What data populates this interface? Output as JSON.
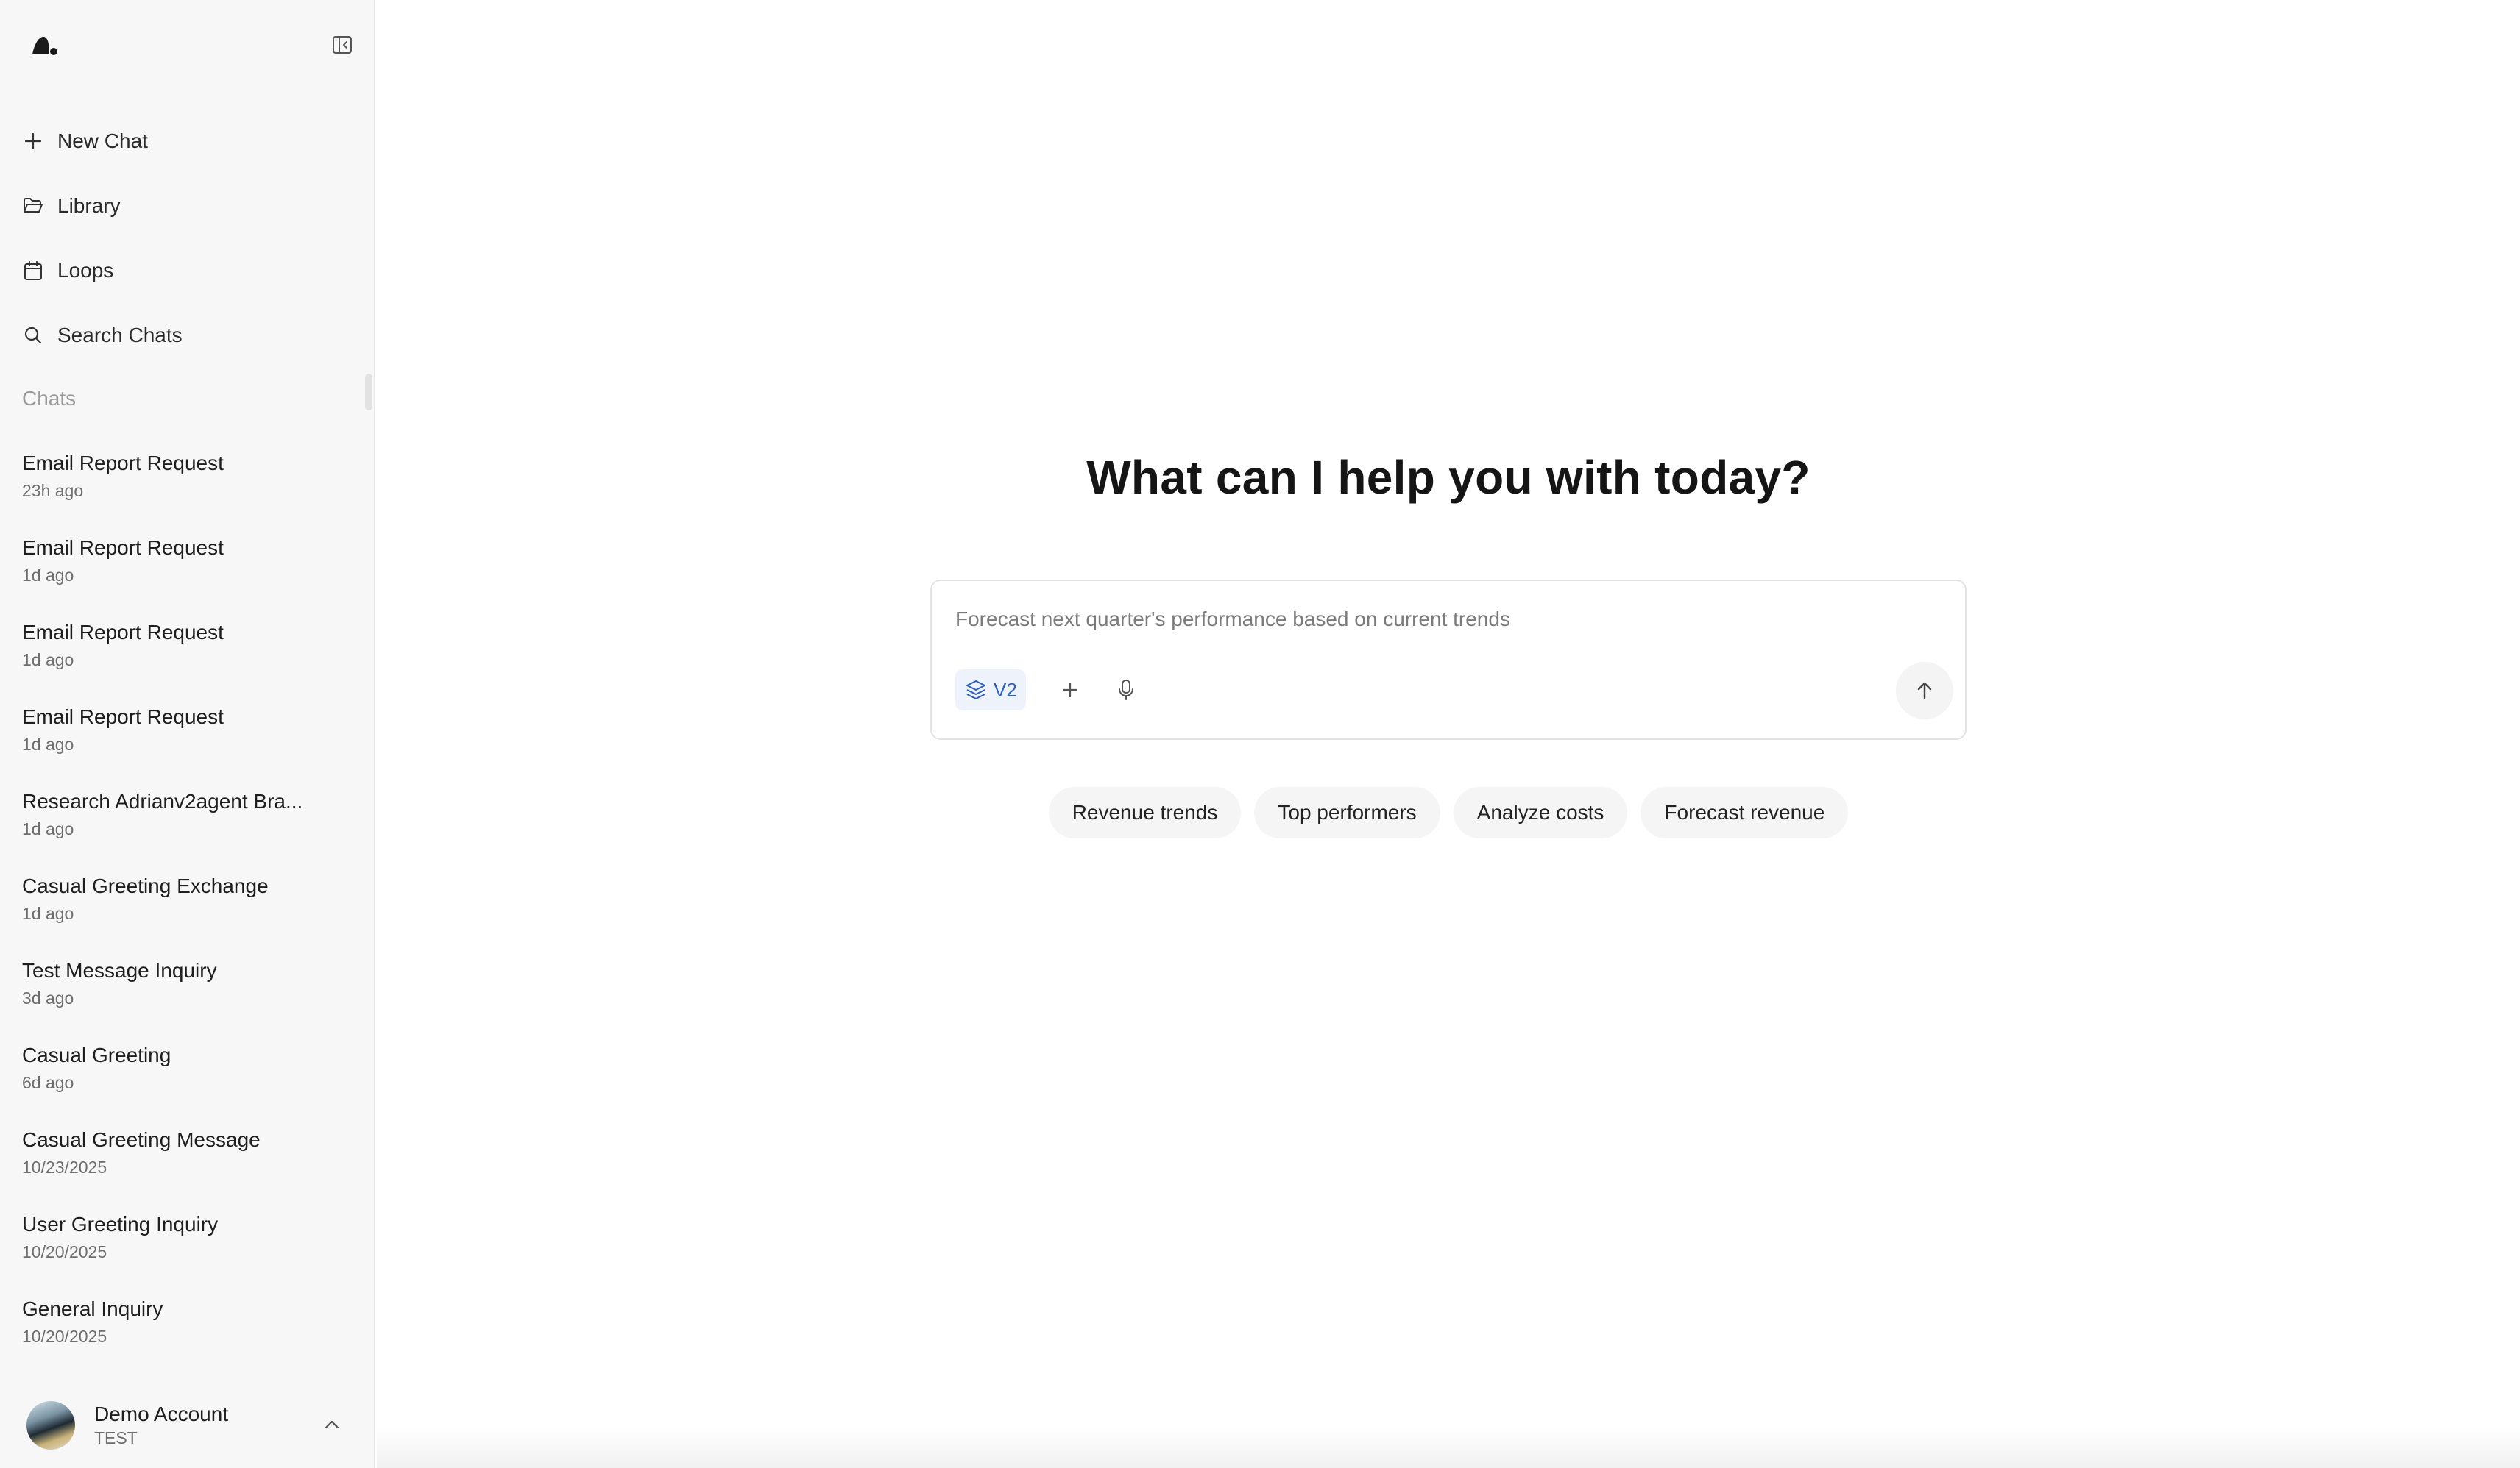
{
  "sidebar": {
    "nav": [
      {
        "label": "New Chat",
        "icon": "plus-icon"
      },
      {
        "label": "Library",
        "icon": "folder-icon"
      },
      {
        "label": "Loops",
        "icon": "calendar-icon"
      },
      {
        "label": "Search Chats",
        "icon": "search-icon"
      }
    ],
    "section_label": "Chats",
    "chats": [
      {
        "title": "Email Report Request",
        "time": "23h ago"
      },
      {
        "title": "Email Report Request",
        "time": "1d ago"
      },
      {
        "title": "Email Report Request",
        "time": "1d ago"
      },
      {
        "title": "Email Report Request",
        "time": "1d ago"
      },
      {
        "title": "Research Adrianv2agent Bra...",
        "time": "1d ago"
      },
      {
        "title": "Casual Greeting Exchange",
        "time": "1d ago"
      },
      {
        "title": "Test Message Inquiry",
        "time": "3d ago"
      },
      {
        "title": "Casual Greeting",
        "time": "6d ago"
      },
      {
        "title": "Casual Greeting Message",
        "time": "10/23/2025"
      },
      {
        "title": "User Greeting Inquiry",
        "time": "10/20/2025"
      },
      {
        "title": "General Inquiry",
        "time": "10/20/2025"
      }
    ],
    "account": {
      "name": "Demo Account",
      "sub": "TEST"
    }
  },
  "main": {
    "headline": "What can I help you with today?",
    "composer": {
      "placeholder": "Forecast next quarter's performance based on current trends",
      "model_label": "V2"
    },
    "suggestions": [
      "Revenue trends",
      "Top performers",
      "Analyze costs",
      "Forecast revenue"
    ]
  },
  "colors": {
    "sidebar_bg": "#f7f7f7",
    "accent": "#2b5fbf",
    "chip_bg": "#f5f5f5"
  }
}
